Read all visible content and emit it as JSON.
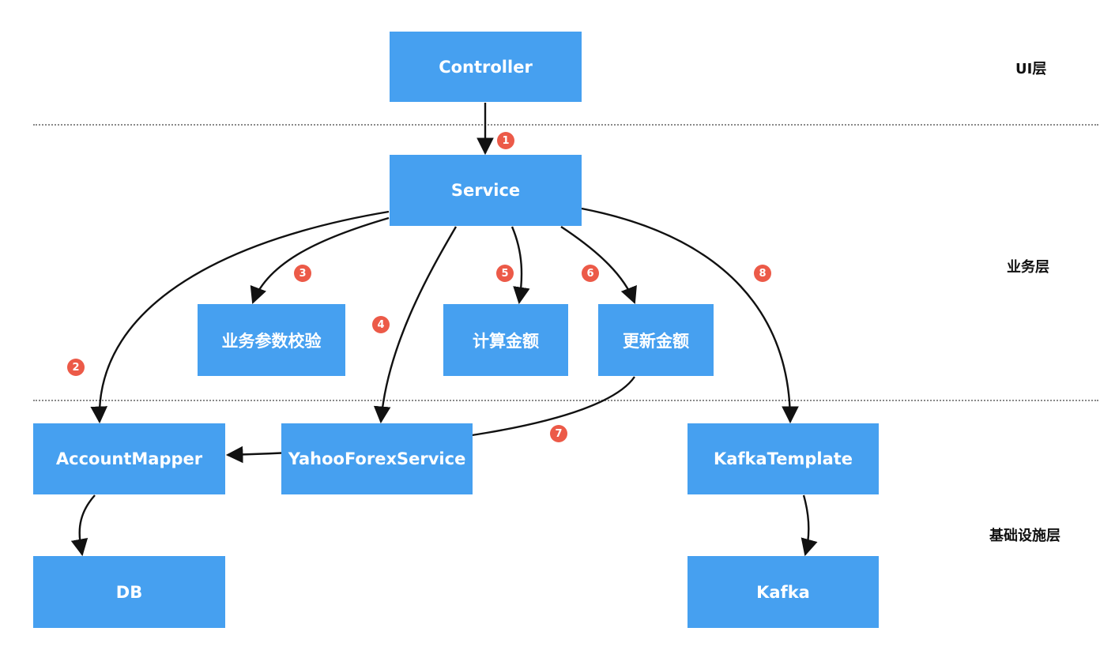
{
  "boxes": {
    "controller": "Controller",
    "service": "Service",
    "validate": "业务参数校验",
    "calculate": "计算金额",
    "update": "更新金额",
    "account_mapper": "AccountMapper",
    "yahoo_forex": "YahooForexService",
    "kafka_template": "KafkaTemplate",
    "db": "DB",
    "kafka": "Kafka"
  },
  "layers": {
    "ui": "UI层",
    "business": "业务层",
    "infrastructure": "基础设施层"
  },
  "steps": [
    "1",
    "2",
    "3",
    "4",
    "5",
    "6",
    "7",
    "8"
  ],
  "colors": {
    "box": "#46a0f0",
    "badge": "#ec5a48",
    "arrow": "#111111",
    "divider": "#8a8a8a"
  }
}
